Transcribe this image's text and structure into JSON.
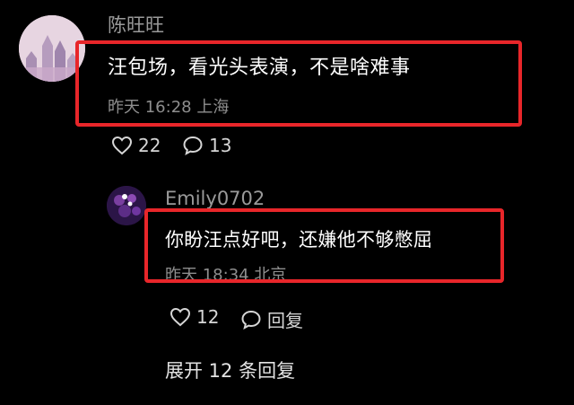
{
  "comment": {
    "username": "陈旺旺",
    "text": "汪包场，看光头表演，不是啥难事",
    "meta": "昨天 16:28 上海",
    "likes": "22",
    "replies": "13"
  },
  "reply": {
    "username": "Emily0702",
    "text": "你盼汪点好吧，还嫌他不够憋屈",
    "meta": "昨天 18:34 北京",
    "likes": "12",
    "reply_label": "回复"
  },
  "expand_label": "展开 12 条回复",
  "colors": {
    "background": "#000000",
    "highlight": "#e8262a",
    "secondary_text": "#9a9a9a"
  },
  "icons": [
    "heart-outline-icon",
    "speech-bubble-icon"
  ]
}
